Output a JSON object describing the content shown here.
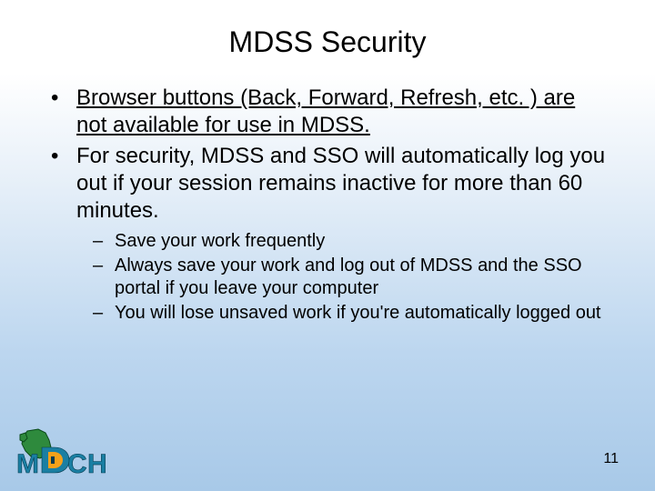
{
  "title": "MDSS Security",
  "bullets": [
    {
      "text": "Browser buttons (Back, Forward, Refresh, etc. ) are not available for use in MDSS. ",
      "underlined": true
    },
    {
      "text": "For security, MDSS and SSO will automatically log you out if your session remains inactive for more than 60 minutes.",
      "underlined": false
    }
  ],
  "sub_bullets": [
    "Save your work frequently",
    "Always save your work and log out of MDSS and the SSO portal if you leave your computer",
    "You will lose unsaved work if you're automatically logged out"
  ],
  "page_number": "11",
  "logo_alt": "MDCH"
}
